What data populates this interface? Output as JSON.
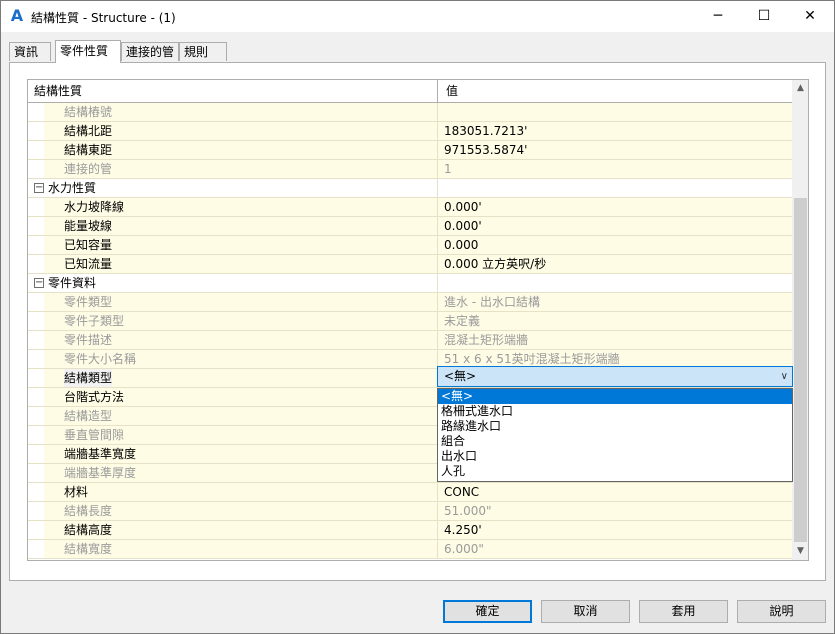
{
  "window": {
    "title": "結構性質 - Structure - (1)",
    "minimize_label": "─",
    "maximize_label": "☐",
    "close_label": "✕",
    "app_icon": "A"
  },
  "tabs": [
    {
      "label": "資訊"
    },
    {
      "label": "零件性質"
    },
    {
      "label": "連接的管"
    },
    {
      "label": "規則"
    }
  ],
  "grid": {
    "header_property": "結構性質",
    "header_value": "值",
    "rows": [
      {
        "property": "結構樁號",
        "value": "",
        "style": "grey"
      },
      {
        "property": "結構北距",
        "value": "183051.7213'",
        "style": "normal"
      },
      {
        "property": "結構東距",
        "value": "971553.5874'",
        "style": "normal"
      },
      {
        "property": "連接的管",
        "value": "1",
        "style": "grey"
      },
      {
        "property": "水力性質",
        "value": "",
        "style": "category",
        "toggle": "⊟"
      },
      {
        "property": "水力坡降線",
        "value": "0.000'",
        "style": "normal"
      },
      {
        "property": "能量坡線",
        "value": "0.000'",
        "style": "normal"
      },
      {
        "property": "已知容量",
        "value": "0.000",
        "style": "normal"
      },
      {
        "property": "已知流量",
        "value": "0.000 立方英呎/秒",
        "style": "normal"
      },
      {
        "property": "零件資料",
        "value": "",
        "style": "category",
        "toggle": "⊟"
      },
      {
        "property": "零件類型",
        "value": "進水 - 出水口結構",
        "style": "grey"
      },
      {
        "property": "零件子類型",
        "value": "未定義",
        "style": "grey"
      },
      {
        "property": "零件描述",
        "value": "混凝土矩形端牆",
        "style": "grey"
      },
      {
        "property": "零件大小名稱",
        "value": "51 x 6 x 51英吋混凝土矩形端牆",
        "style": "grey"
      },
      {
        "property": "結構類型",
        "value": "",
        "style": "selected"
      },
      {
        "property": "台階式方法",
        "value": "",
        "style": "normal"
      },
      {
        "property": "結構造型",
        "value": "",
        "style": "grey"
      },
      {
        "property": "垂直管間隙",
        "value": "",
        "style": "grey"
      },
      {
        "property": "端牆基準寬度",
        "value": "",
        "style": "normal"
      },
      {
        "property": "端牆基準厚度",
        "value": "",
        "style": "grey"
      },
      {
        "property": "材料",
        "value": "CONC",
        "style": "normal"
      },
      {
        "property": "結構長度",
        "value": "51.000\"",
        "style": "grey"
      },
      {
        "property": "結構高度",
        "value": "4.250'",
        "style": "normal"
      },
      {
        "property": "結構寬度",
        "value": "6.000\"",
        "style": "grey"
      }
    ]
  },
  "combo": {
    "selected": "<無>",
    "options": [
      "<無>",
      "格柵式進水口",
      "路緣進水口",
      "組合",
      "出水口",
      "人孔"
    ]
  },
  "buttons": {
    "ok": "確定",
    "cancel": "取消",
    "apply": "套用",
    "help": "說明"
  },
  "colors": {
    "row_background": "#fffce6",
    "accent": "#0078d7",
    "combo_background": "#cce4f7"
  }
}
